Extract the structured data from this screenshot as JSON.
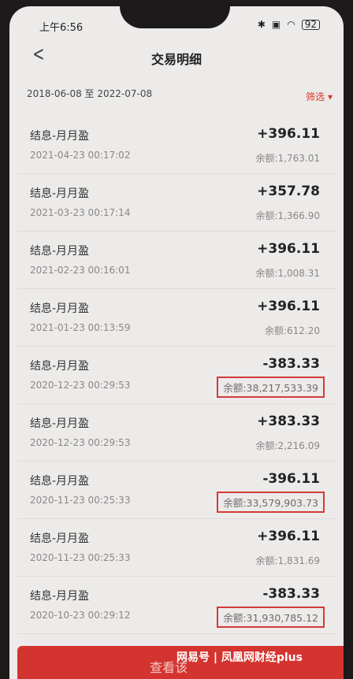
{
  "status": {
    "time": "上午6:56",
    "battery": "92"
  },
  "header": {
    "title": "交易明细"
  },
  "filter": {
    "date_range": "2018-06-08 至 2022-07-08",
    "filter_label": "筛选"
  },
  "transactions": [
    {
      "title": "结息-月月盈",
      "time": "2021-04-23 00:17:02",
      "amount": "+396.11",
      "balance": "余额:1,763.01",
      "highlight": false
    },
    {
      "title": "结息-月月盈",
      "time": "2021-03-23 00:17:14",
      "amount": "+357.78",
      "balance": "余额:1,366.90",
      "highlight": false
    },
    {
      "title": "结息-月月盈",
      "time": "2021-02-23 00:16:01",
      "amount": "+396.11",
      "balance": "余额:1,008.31",
      "highlight": false
    },
    {
      "title": "结息-月月盈",
      "time": "2021-01-23 00:13:59",
      "amount": "+396.11",
      "balance": "余额:612.20",
      "highlight": false
    },
    {
      "title": "结息-月月盈",
      "time": "2020-12-23 00:29:53",
      "amount": "-383.33",
      "balance": "余额:38,217,533.39",
      "highlight": true
    },
    {
      "title": "结息-月月盈",
      "time": "2020-12-23 00:29:53",
      "amount": "+383.33",
      "balance": "余额:2,216.09",
      "highlight": false
    },
    {
      "title": "结息-月月盈",
      "time": "2020-11-23 00:25:33",
      "amount": "-396.11",
      "balance": "余额:33,579,903.73",
      "highlight": true
    },
    {
      "title": "结息-月月盈",
      "time": "2020-11-23 00:25:33",
      "amount": "+396.11",
      "balance": "余额:1,831.69",
      "highlight": false
    },
    {
      "title": "结息-月月盈",
      "time": "2020-10-23 00:29:12",
      "amount": "-383.33",
      "balance": "余额:31,930,785.12",
      "highlight": true
    }
  ],
  "bottom": {
    "button_label": "查看该"
  },
  "watermark": {
    "text": "网易号 | 凤凰网财经plus"
  },
  "colors": {
    "accent": "#d4342f",
    "highlight_border": "#d43b36"
  }
}
